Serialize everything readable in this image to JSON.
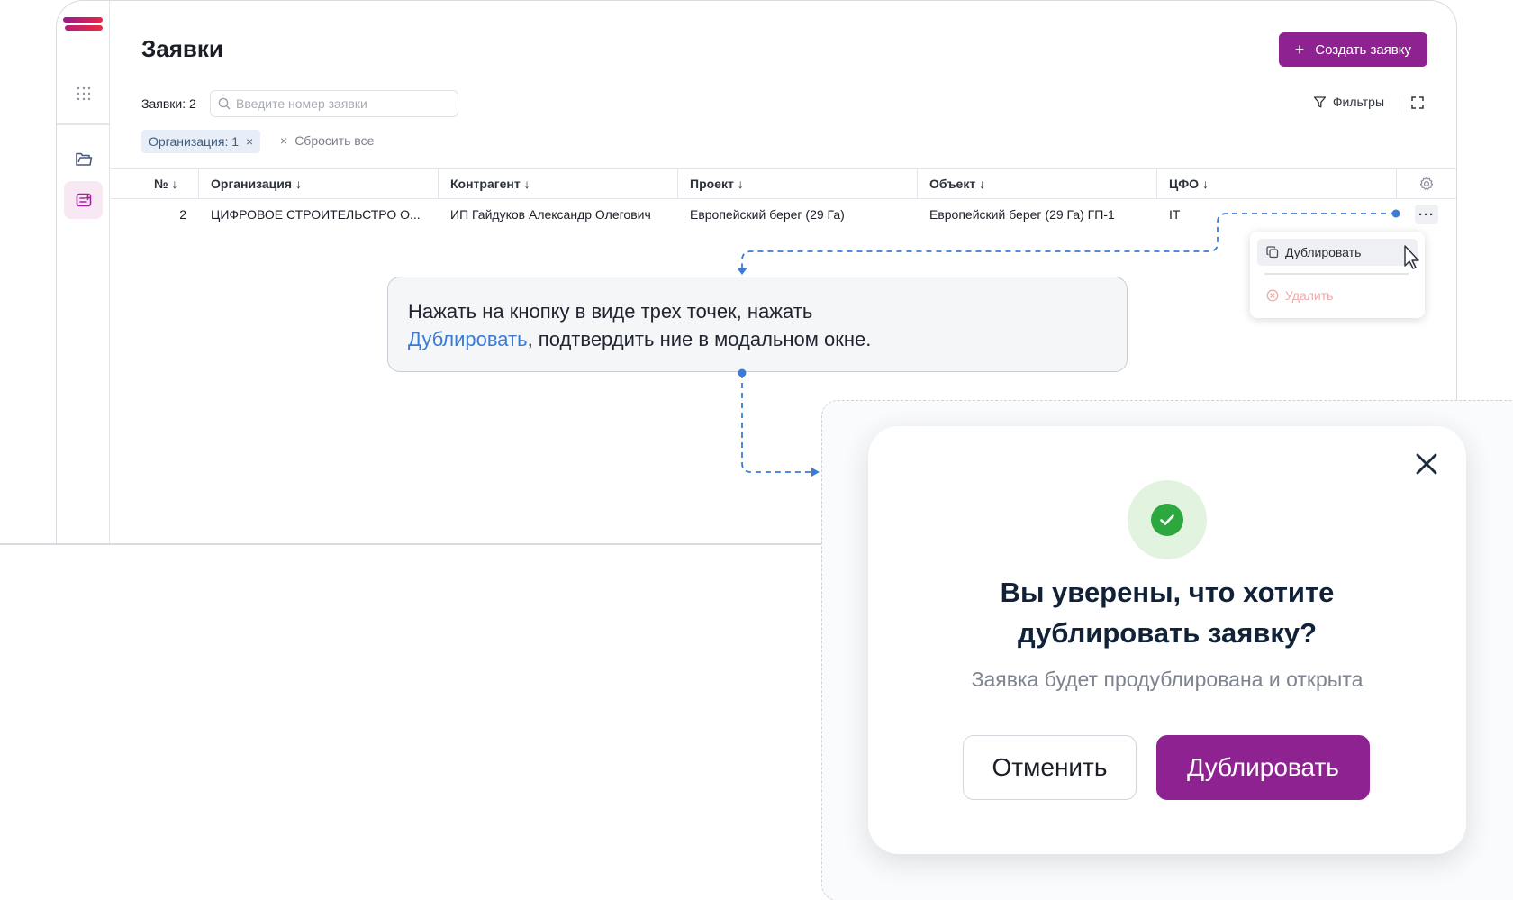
{
  "page": {
    "title": "Заявки",
    "create_label": "Создать заявку",
    "create_icon": "+"
  },
  "toolbar": {
    "count_label": "Заявки: 2",
    "search_placeholder": "Введите номер заявки",
    "filters_label": "Фильтры"
  },
  "chips": {
    "org_label": "Организация: 1",
    "org_remove": "×",
    "reset_icon": "×",
    "reset_label": "Сбросить все"
  },
  "table": {
    "headers": {
      "num": "№ ↓",
      "org": "Организация ↓",
      "contractor": "Контрагент ↓",
      "project": "Проект ↓",
      "object": "Объект ↓",
      "cfo": "ЦФО ↓"
    },
    "rows": [
      {
        "num": "2",
        "org": "ЦИФРОВОЕ СТРОИТЕЛЬСТРО О...",
        "contractor": "ИП Гайдуков Александр Олегович",
        "project": "Европейский берег (29 Га)",
        "object": "Европейский берег (29 Га) ГП-1",
        "cfo": "IT",
        "more": "···"
      }
    ]
  },
  "menu": {
    "duplicate": "Дублировать",
    "delete": "Удалить"
  },
  "callout": {
    "text_before": "Нажать на кнопку в виде трех точек, нажать",
    "link": "Дублировать",
    "text_after": ", подтвердить ние в модальном окне."
  },
  "modal": {
    "title_line1": "Вы уверены, что хотите",
    "title_line2": "дублировать заявку?",
    "subtitle": "Заявка будет продублирована и открыта",
    "cancel": "Отменить",
    "confirm": "Дублировать"
  },
  "colors": {
    "brand": "#8f2291",
    "link": "#3a7bd5",
    "success": "#2ca83e",
    "success_bg": "#e2f4df",
    "annotation": "#3a7bd5"
  },
  "icons": [
    "logo",
    "apps-grid-icon",
    "folder-icon",
    "requests-icon",
    "search-icon",
    "filter-icon",
    "expand-icon",
    "gear-icon",
    "more-icon",
    "copy-icon",
    "delete-icon",
    "cursor-icon",
    "close-icon",
    "check-icon"
  ]
}
